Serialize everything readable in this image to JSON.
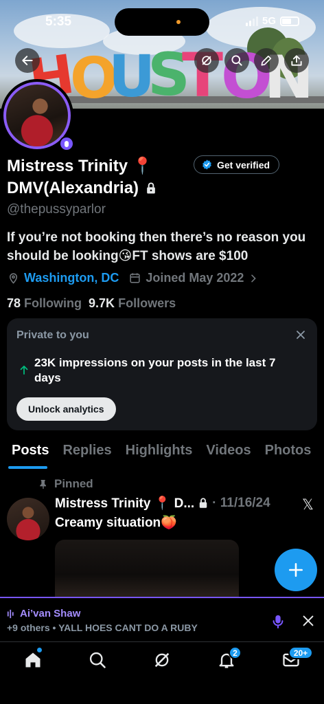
{
  "status": {
    "time": "5:35",
    "network": "5G"
  },
  "profile": {
    "name_line1": "Mistress Trinity 📍",
    "name_line2": "DMV(Alexandria)",
    "handle": "@thepussyparlor",
    "bio": "If you’re not booking then there’s no reason you should be looking😘FT shows are $100",
    "location": "Washington, DC",
    "joined": "Joined May 2022",
    "following_count": "78",
    "following_label": "Following",
    "followers_count": "9.7K",
    "followers_label": "Followers",
    "get_verified": "Get verified"
  },
  "analytics": {
    "title": "Private to you",
    "impressions": "23K impressions on your posts in the last 7 days",
    "button": "Unlock analytics"
  },
  "tabs": [
    "Posts",
    "Replies",
    "Highlights",
    "Videos",
    "Photos"
  ],
  "post": {
    "pinned_label": "Pinned",
    "author": "Mistress Trinity 📍 D...",
    "date": "· 11/16/24",
    "text": "Creamy situation🍑"
  },
  "space": {
    "host": "Ai’van Shaw",
    "subtitle": "+9 others • YALL HOES CANT DO A RUBY"
  },
  "nav": {
    "notifications_badge": "2",
    "messages_badge": "20+"
  },
  "colors": {
    "accent": "#1d9bf0",
    "spaces": "#7856ff",
    "background": "#000000"
  }
}
